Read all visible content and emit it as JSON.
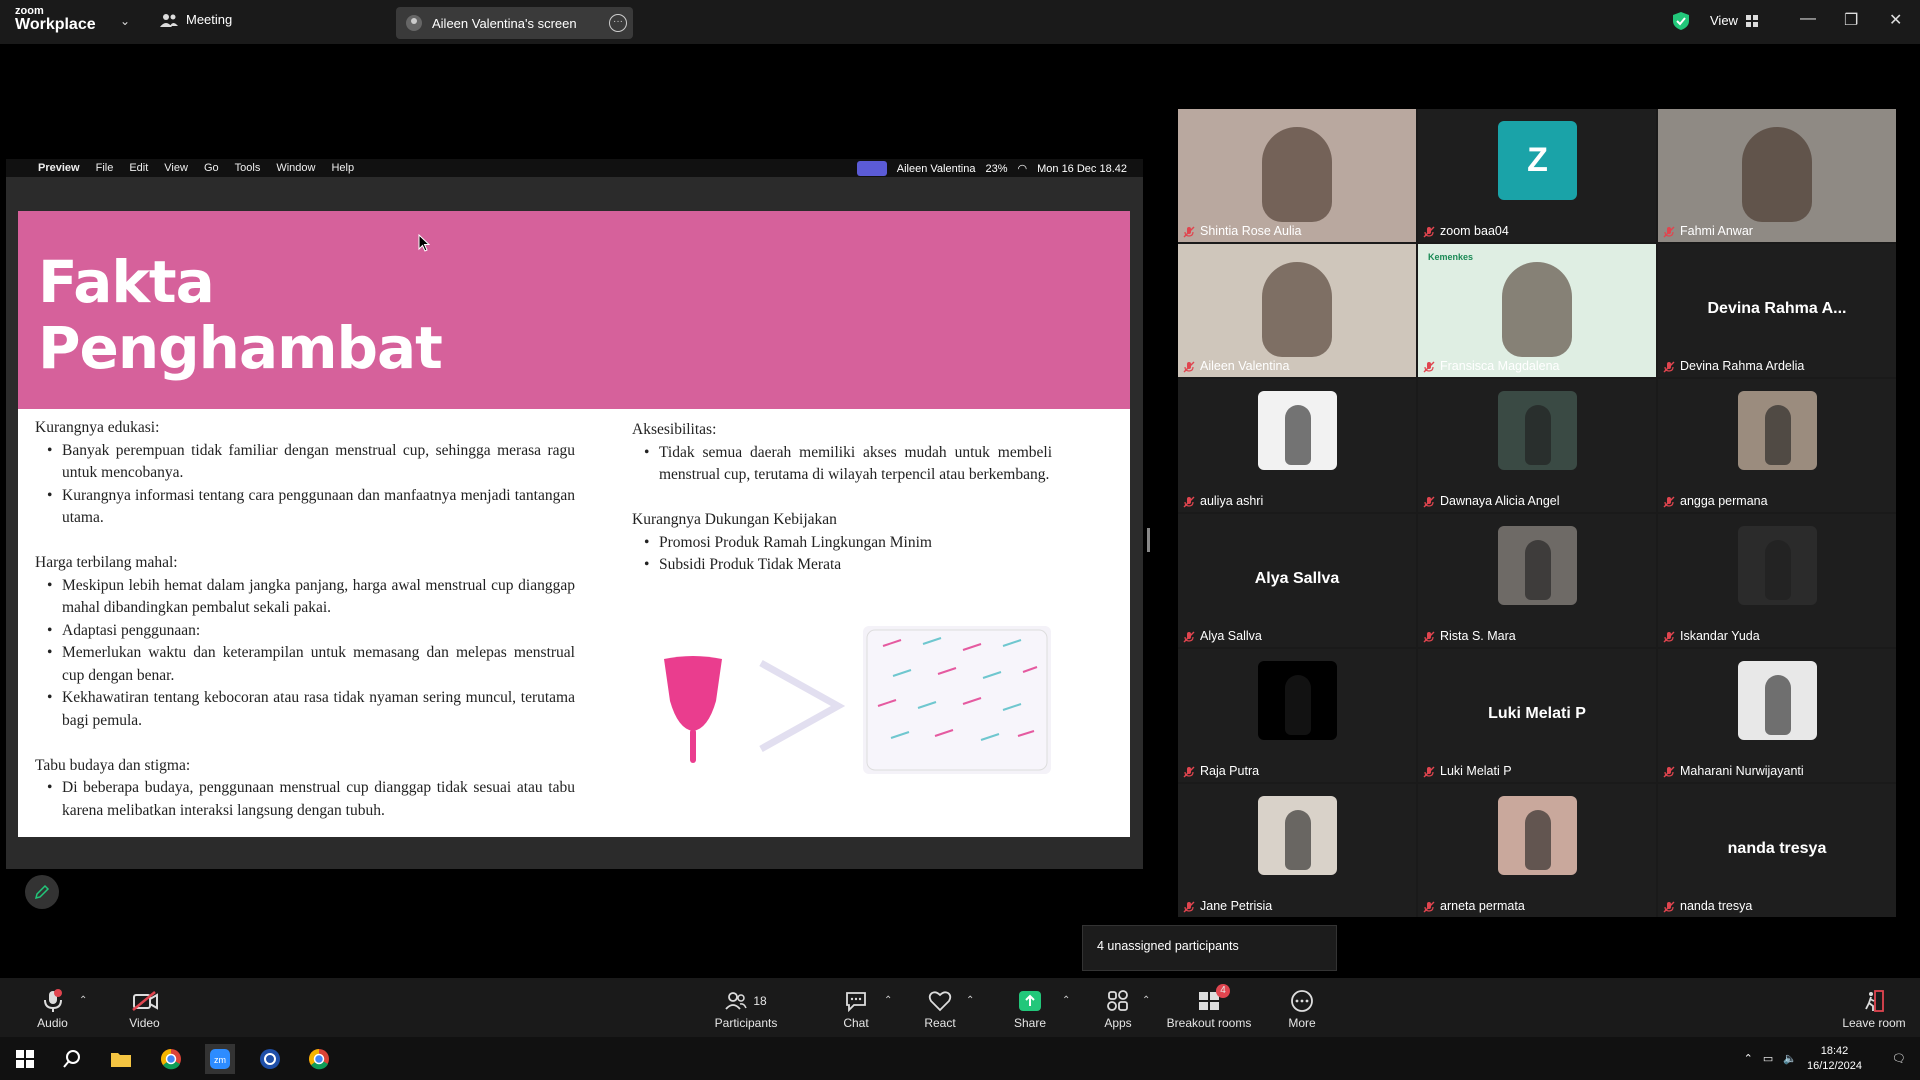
{
  "app": {
    "logo_small": "zoom",
    "logo_big": "Workplace",
    "meeting_label": "Meeting",
    "screen_share_label": "Aileen Valentina's screen",
    "view_label": "View"
  },
  "mac_menubar": {
    "app_name": "Preview",
    "menus": [
      "File",
      "Edit",
      "View",
      "Go",
      "Tools",
      "Window",
      "Help"
    ],
    "user": "Aileen Valentina",
    "battery": "23%",
    "datetime": "Mon 16 Dec  18.42"
  },
  "slide": {
    "title_line1": "Fakta",
    "title_line2": "Penghambat",
    "left": {
      "s1_head": "Kurangnya edukasi:",
      "s1_b1": "Banyak perempuan tidak familiar dengan menstrual cup, sehingga merasa ragu untuk mencobanya.",
      "s1_b2": "Kurangnya informasi tentang cara penggunaan dan manfaatnya menjadi tantangan utama.",
      "s2_head": "Harga terbilang mahal:",
      "s2_b1": "Meskipun lebih hemat dalam jangka panjang, harga awal menstrual cup dianggap mahal dibandingkan pembalut sekali pakai.",
      "s2_b2": "Adaptasi penggunaan:",
      "s2_b3": "Memerlukan waktu dan keterampilan untuk memasang dan melepas menstrual cup dengan benar.",
      "s2_b4": "Kekhawatiran tentang kebocoran atau rasa tidak nyaman sering muncul, terutama bagi pemula.",
      "s3_head": "Tabu budaya dan stigma:",
      "s3_b1": "Di beberapa budaya, penggunaan menstrual cup dianggap tidak sesuai atau tabu karena melibatkan interaksi langsung dengan tubuh."
    },
    "right": {
      "s1_head": "Aksesibilitas:",
      "s1_b1": "Tidak semua daerah memiliki akses mudah untuk membeli menstrual cup, terutama di wilayah terpencil atau berkembang.",
      "s2_head": "Kurangnya Dukungan Kebijakan",
      "s2_b1": "Promosi Produk Ramah Lingkungan Minim",
      "s2_b2": "Subsidi Produk Tidak Merata"
    }
  },
  "participants": [
    {
      "name": "Shintia Rose Aulia",
      "kind": "video",
      "color": "#b9a89f"
    },
    {
      "name": "zoom baa04",
      "kind": "letter",
      "letter": "Z",
      "color": "#1aa3a8"
    },
    {
      "name": "Fahmi Anwar",
      "kind": "video",
      "color": "#8f8a84"
    },
    {
      "name": "Aileen Valentina",
      "kind": "video",
      "color": "#cfc6bb"
    },
    {
      "name": "Fransisca Magdalena",
      "kind": "video",
      "color": "#dfeee3",
      "overlay": "Kemenkes"
    },
    {
      "name": "Devina Rahma Ardelia",
      "kind": "text",
      "display": "Devina  Rahma  A..."
    },
    {
      "name": "auliya ashri",
      "kind": "avatar",
      "color": "#f2f2f2"
    },
    {
      "name": "Dawnaya Alicia Angel",
      "kind": "avatar",
      "color": "#3a4a44"
    },
    {
      "name": "angga permana",
      "kind": "avatar",
      "color": "#9b8c7e"
    },
    {
      "name": "Alya Sallva",
      "kind": "text",
      "display": "Alya Sallva"
    },
    {
      "name": "Rista S. Mara",
      "kind": "avatar",
      "color": "#6e6a66"
    },
    {
      "name": "Iskandar Yuda",
      "kind": "avatar",
      "color": "#2b2b2b"
    },
    {
      "name": "Raja Putra",
      "kind": "avatar",
      "color": "#000000"
    },
    {
      "name": "Luki Melati P",
      "kind": "text",
      "display": "Luki Melati P"
    },
    {
      "name": "Maharani Nurwijayanti",
      "kind": "avatar",
      "color": "#e8e8e8"
    },
    {
      "name": "Jane Petrisia",
      "kind": "avatar",
      "color": "#d9d2c9"
    },
    {
      "name": "arneta permata",
      "kind": "avatar",
      "color": "#c9a89c"
    },
    {
      "name": "nanda tresya",
      "kind": "text",
      "display": "nanda tresya"
    }
  ],
  "breakout_popup": "4 unassigned participants",
  "toolbar": {
    "audio": "Audio",
    "video": "Video",
    "participants": "Participants",
    "participants_count": "18",
    "chat": "Chat",
    "react": "React",
    "share": "Share",
    "apps": "Apps",
    "breakout": "Breakout rooms",
    "breakout_badge": "4",
    "more": "More",
    "leave": "Leave room"
  },
  "taskbar": {
    "time": "18:42",
    "date": "16/12/2024"
  },
  "colors": {
    "slide_header": "#d6619b",
    "share_green": "#22c77a",
    "mic_muted": "#e0454f"
  }
}
